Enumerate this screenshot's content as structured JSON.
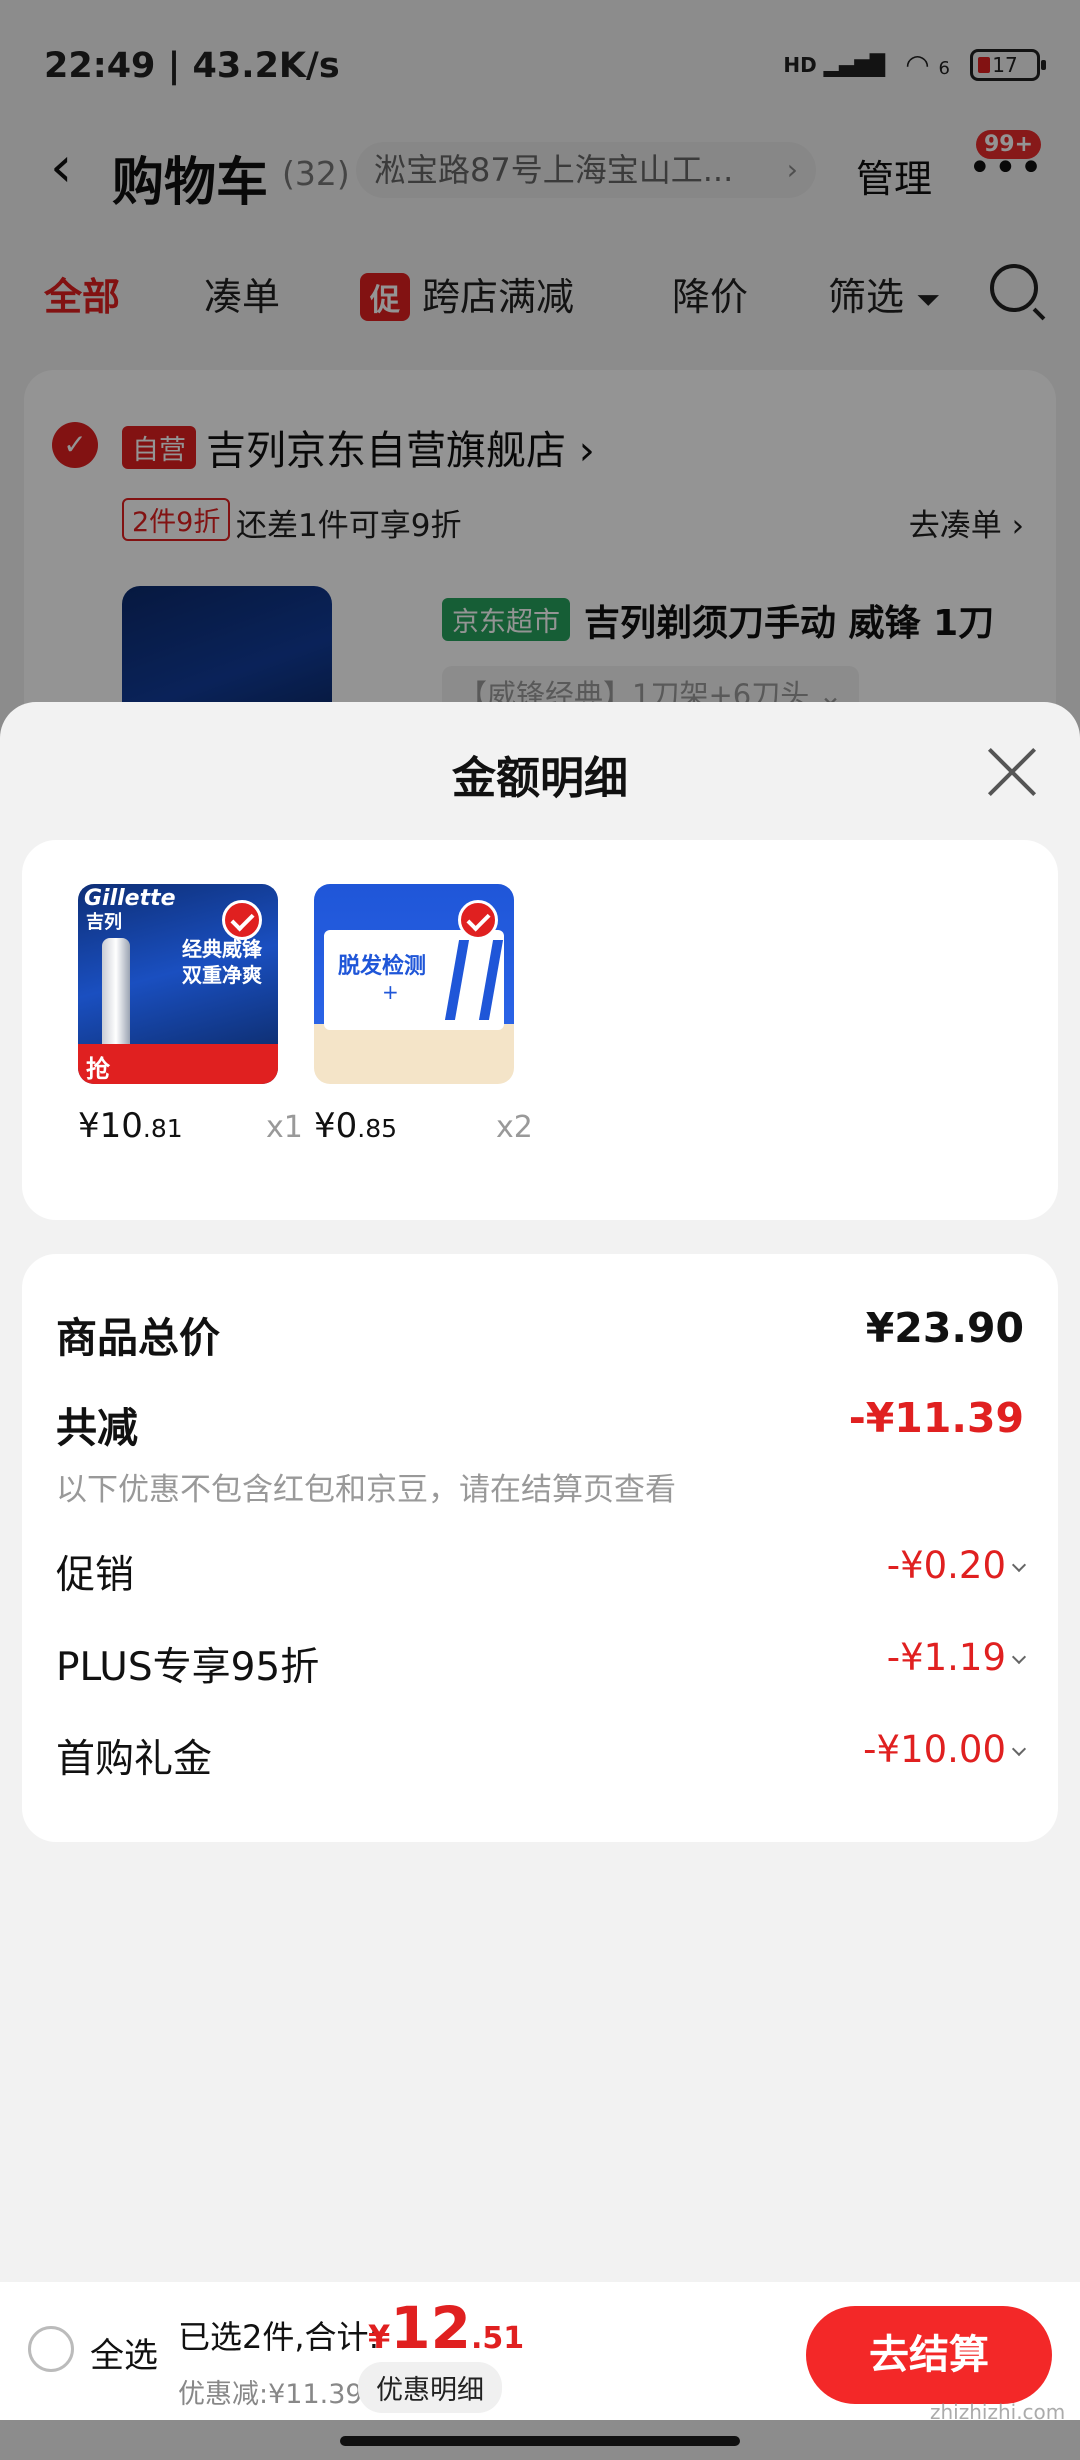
{
  "status_bar": {
    "time": "22:49 | 43.2K/s",
    "signal": "HD",
    "wifi": "6",
    "battery": "17"
  },
  "header": {
    "title": "购物车",
    "count": "(32)",
    "address": "淞宝路87号上海宝山工...",
    "manage": "管理",
    "more": "•••",
    "badge": "99+"
  },
  "filter_tabs": [
    {
      "label": "全部"
    },
    {
      "label": "凑单"
    },
    {
      "promo_tag": "促",
      "label": "跨店满减"
    },
    {
      "label": "降价"
    },
    {
      "label": "筛选"
    }
  ],
  "store": {
    "self_tag": "自营",
    "name": "吉列京东自营旗舰店 ›",
    "discount_tag": "2件9折",
    "discount_text": "还差1件可享9折",
    "go_collect": "去凑单 ›",
    "product": {
      "market_tag": "京东超市",
      "title": "吉列剃须刀手动 威锋 1刀",
      "variant": "【威锋经典】1刀架+6刀头 ⌄"
    }
  },
  "sheet": {
    "title": "金额明细",
    "items": [
      {
        "brand": "Gillette",
        "brand_cn": "吉列",
        "headline": "经典威锋 双重净爽",
        "promo": "抢",
        "price_int": "¥10",
        "price_dec": ".81",
        "qty": "x1"
      },
      {
        "headline": "脱发检测",
        "plus": "+",
        "price_int": "¥0",
        "price_dec": ".85",
        "qty": "x2"
      }
    ],
    "summary": {
      "goods_total_label": "商品总价",
      "goods_total_value": "¥23.90",
      "total_discount_label": "共减",
      "total_discount_value": "-¥11.39",
      "note": "以下优惠不包含红包和京豆，请在结算页查看",
      "rows": [
        {
          "label": "促销",
          "value": "-¥0.20"
        },
        {
          "label": "PLUS专享95折",
          "value": "-¥1.19"
        },
        {
          "label": "首购礼金",
          "value": "-¥10.00"
        }
      ]
    }
  },
  "checkout": {
    "select_all": "全选",
    "selected_summary": "已选2件,合计:",
    "total_symbol": "¥",
    "total_int": "12",
    "total_dec": ".51",
    "saved": "优惠减:¥11.39",
    "detail_button": "优惠明细",
    "checkout_button": "去结算"
  },
  "watermark": "zhizhizhi.com",
  "colors": {
    "accent": "#e02020",
    "checkout_button": "#f32828",
    "market_tag": "#27a35d"
  }
}
